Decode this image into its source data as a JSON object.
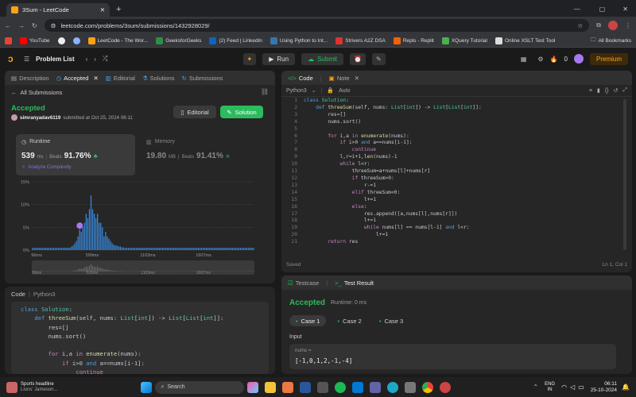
{
  "browser": {
    "tab_title": "3Sum - LeetCode",
    "url": "leetcode.com/problems/3sum/submissions/1432928029/"
  },
  "bookmarks": [
    "YouTube",
    "",
    "",
    "LeetCode - The Wor...",
    "GeeksforGeeks",
    "(2) Feed | LinkedIn",
    "Using Python to Int...",
    "Strivers A2Z DSA",
    "Repls - Replit",
    "XQuery Tutorial",
    "Online XSLT Test Tool"
  ],
  "bookmarks_all": "All Bookmarks",
  "nav": {
    "problem_list": "Problem List",
    "run": "Run",
    "submit": "Submit",
    "streak": "0",
    "premium": "Premium"
  },
  "left_tabs": [
    "Description",
    "Accepted",
    "Editorial",
    "Solutions",
    "Submissions"
  ],
  "all_submissions": "All Submissions",
  "result": {
    "status": "Accepted",
    "user": "simranyadav6119",
    "submitted": "submitted at Oct 25, 2024 06:11",
    "editorial_btn": "Editorial",
    "solution_btn": "Solution"
  },
  "runtime": {
    "label": "Runtime",
    "value": "539",
    "unit": "ms",
    "beats_label": "Beats",
    "beats": "91.76%",
    "analyze": "Analyze Complexity"
  },
  "memory": {
    "label": "Memory",
    "value": "19.80",
    "unit": "MB",
    "beats_label": "Beats",
    "beats": "91.41%"
  },
  "chart_data": {
    "type": "bar",
    "y_ticks": [
      "15%",
      "10%",
      "5%",
      "0%"
    ],
    "ylim": [
      0,
      15
    ],
    "x_ticks": [
      "96ms",
      "599ms",
      "1103ms",
      "1607ms"
    ],
    "values": [
      0.5,
      0.5,
      0.5,
      0.5,
      0.5,
      0.5,
      0.5,
      0.5,
      0.5,
      0.5,
      0.5,
      0.5,
      0.5,
      0.5,
      0.5,
      0.5,
      0.5,
      0.5,
      0.5,
      0.5,
      0.5,
      0.5,
      0.5,
      0.5,
      0.8,
      1,
      1.5,
      2,
      3,
      4.5,
      4,
      5,
      6,
      8,
      7,
      9,
      12,
      9,
      8,
      7,
      8,
      6,
      6,
      5,
      3,
      4,
      3,
      2.5,
      2,
      1.5,
      1.2,
      1,
      1,
      0.8,
      0.8,
      0.6,
      0.6,
      0.5,
      0.5,
      0.5,
      0.5,
      0.5,
      0.5,
      0.5,
      0.5,
      0.5,
      0.5,
      0.5,
      0.5,
      0.5,
      0.5,
      0.5,
      0.5,
      0.5,
      0.5,
      0.5,
      0.5,
      0.5,
      0.5,
      0.5,
      0.5,
      0.5,
      0.5,
      0.5,
      0.5,
      0.5,
      0.5,
      0.5,
      0.5,
      0.5,
      0.5,
      0.5,
      0.5,
      0.5,
      0.5,
      0.5,
      0.5,
      0.5,
      0.5,
      0.5,
      0.5,
      0.5,
      0.5,
      0.5,
      0.5,
      0.5,
      0.5,
      0.5,
      0.5,
      0.5,
      0.5,
      0.5,
      0.5,
      0.5,
      0.5,
      0.5,
      0.5,
      0.5,
      0.5,
      0.5,
      0.5,
      0.5,
      0.5,
      0.5,
      0.5,
      0.5,
      0.5,
      0.5,
      0.5,
      0.5,
      0.5,
      0.5,
      0.5,
      0.5,
      0.5,
      0.5,
      0.5
    ],
    "highlight_index": 29
  },
  "code_panel": {
    "label": "Code",
    "lang": "Python3"
  },
  "editor": {
    "tab_code": "Code",
    "tab_note": "Note",
    "lang": "Python3",
    "auto": "Auto",
    "saved": "Saved",
    "position": "Ln 1, Col 1"
  },
  "testcase": {
    "tab_testcase": "Testcase",
    "tab_result": "Test Result",
    "status": "Accepted",
    "runtime": "Runtime: 0 ms",
    "cases": [
      "Case 1",
      "Case 2",
      "Case 3"
    ],
    "input_label": "Input",
    "var": "nums =",
    "value": "[-1,0,1,2,-1,-4]"
  },
  "taskbar": {
    "news_title": "Sports headline",
    "news_sub": "Lions' Jameson...",
    "search": "Search",
    "lang1": "ENG",
    "lang2": "IN",
    "time": "06:11",
    "date": "25-10-2024"
  },
  "colors": {
    "accent": "#2cbb5d",
    "premium": "#ffa116"
  }
}
